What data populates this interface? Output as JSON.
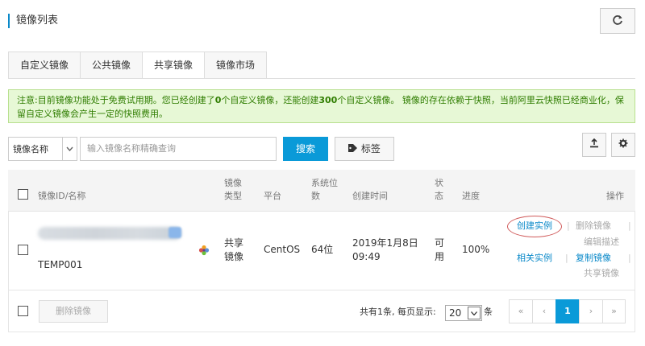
{
  "header": {
    "title": "镜像列表",
    "refresh_icon": "refresh-icon"
  },
  "tabs": [
    {
      "label": "自定义镜像",
      "active": false
    },
    {
      "label": "公共镜像",
      "active": false
    },
    {
      "label": "共享镜像",
      "active": true
    },
    {
      "label": "镜像市场",
      "active": false
    }
  ],
  "notice": {
    "part1": "注意:目前镜像功能处于免费试用期。您已经创建了",
    "count_created": "0",
    "part2": "个自定义镜像，还能创建",
    "count_remaining": "300",
    "part3": "个自定义镜像。 镜像的存在依赖于快照，当前阿里云快照已经商业化，保留自定义镜像会产生一定的快照费用。"
  },
  "search": {
    "field_select": "镜像名称",
    "placeholder": "输入镜像名称精确查询",
    "search_button": "搜索",
    "tag_button": "标签"
  },
  "table": {
    "columns": {
      "id_name": "镜像ID/名称",
      "type_line1": "镜像",
      "type_line2": "类型",
      "platform": "平台",
      "bits_line1": "系统位",
      "bits_line2": "数",
      "created": "创建时间",
      "status_line1": "状",
      "status_line2": "态",
      "progress": "进度",
      "actions": "操作"
    },
    "rows": [
      {
        "name": "TEMP001",
        "type_line1": "共享",
        "type_line2": "镜像",
        "platform": "CentOS",
        "bits": "64位",
        "created_date": "2019年1月8日",
        "created_time": "09:49",
        "status_line1": "可",
        "status_line2": "用",
        "progress": "100%",
        "actions": {
          "create_instance": "创建实例",
          "delete_image": "删除镜像",
          "edit_description": "编辑描述",
          "related_instances": "相关实例",
          "copy_image": "复制镜像",
          "share_image": "共享镜像"
        }
      }
    ]
  },
  "footer": {
    "delete_button": "删除镜像",
    "total_text": "共有1条, 每页显示:",
    "page_size": "20",
    "unit": "条",
    "pager": [
      "«",
      "‹",
      "1",
      "›",
      "»"
    ],
    "current_page": "1"
  },
  "colors": {
    "accent": "#0a9ad8",
    "notice_bg": "#e7f8d6",
    "notice_text": "#2f7d00",
    "highlight_circle": "#d05a5a"
  }
}
